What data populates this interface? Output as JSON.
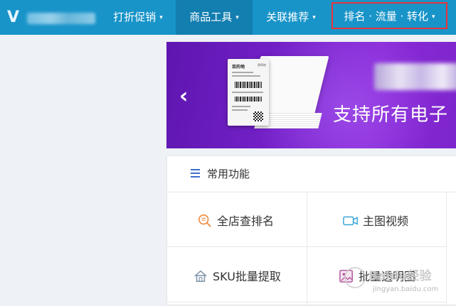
{
  "nav": {
    "items": [
      {
        "label": "打折促销",
        "active": false
      },
      {
        "label": "商品工具",
        "active": true
      },
      {
        "label": "关联推荐",
        "active": false
      },
      {
        "label": "排名 · 流量 · 转化",
        "active": false,
        "highlighted": true
      }
    ],
    "caret": "▾"
  },
  "banner": {
    "card_title": "目的地",
    "card_tag": "原寄地",
    "headline": "支持所有电子",
    "arrow": "‹"
  },
  "panel": {
    "title": "常用功能",
    "tools": [
      {
        "label": "全店查排名",
        "icon": "magnifier-doc-icon"
      },
      {
        "label": "主图视频",
        "icon": "video-camera-icon"
      },
      {
        "label": "SKU批量提取",
        "icon": "house-icon"
      },
      {
        "label": "批量透明图",
        "icon": "image-icon"
      }
    ]
  },
  "watermark": {
    "main": "Baidu经验",
    "sub": "jingyan.baidu.com"
  },
  "colors": {
    "nav_bg": "#1894c9",
    "nav_active": "#137eb0",
    "highlight_border": "#e8333a",
    "banner_purple": "#7421c8",
    "menu_icon": "#3b6fcf"
  }
}
